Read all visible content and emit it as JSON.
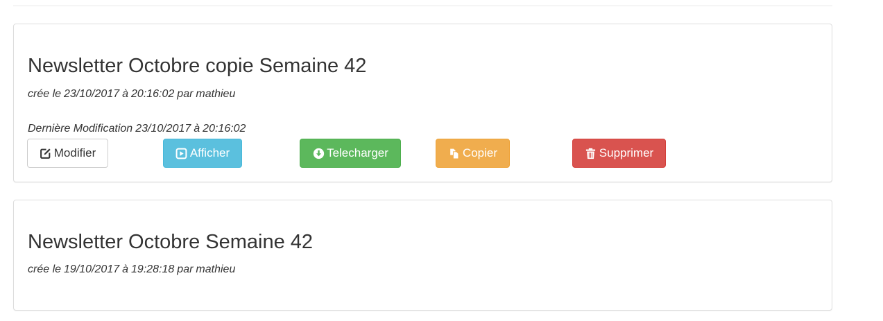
{
  "newsletters": [
    {
      "title": "Newsletter Octobre copie Semaine 42",
      "created_prefix": "crée le",
      "created_date": "23/10/2017",
      "created_at_word": "à",
      "created_time": "20:16:02",
      "created_by_word": "par",
      "created_author": "mathieu",
      "modified_prefix": "Dernière Modification",
      "modified_date": "23/10/2017",
      "modified_at_word": "à",
      "modified_time": "20:16:02",
      "actions": {
        "modifier": "Modifier",
        "afficher": "Afficher",
        "telecharger": "Telecharger",
        "copier": "Copier",
        "supprimer": "Supprimer"
      }
    },
    {
      "title": "Newsletter Octobre Semaine 42",
      "created_prefix": "crée le",
      "created_date": "19/10/2017",
      "created_at_word": "à",
      "created_time": "19:28:18",
      "created_by_word": "par",
      "created_author": "mathieu"
    }
  ],
  "colors": {
    "default_button_bg": "#ffffff",
    "info": "#5bc0de",
    "success": "#5cb85c",
    "warning": "#f0ad4e",
    "danger": "#d9534f",
    "panel_border": "#dddddd"
  },
  "icons": {
    "modifier": "edit-icon",
    "afficher": "play-square-icon",
    "telecharger": "download-circle-icon",
    "copier": "copy-icon",
    "supprimer": "trash-icon"
  }
}
